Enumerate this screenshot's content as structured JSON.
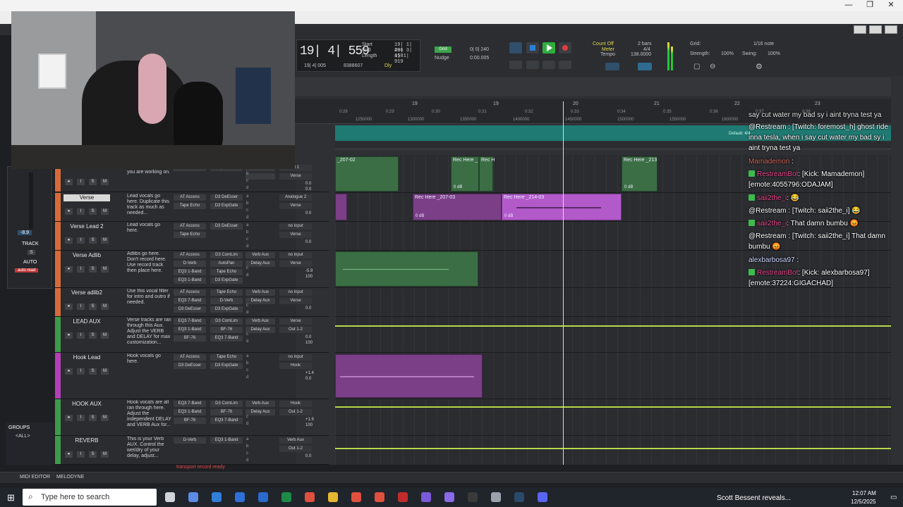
{
  "window": {
    "minimize": "—",
    "restore": "❐",
    "close": "✕"
  },
  "transport": {
    "counter": "19| 4| 559",
    "sub_counter": "19| 4| 005",
    "samples": "8388607",
    "start_label": "Start",
    "end_label": "End",
    "length_label": "Length",
    "start_val": "19| 1| 496",
    "end_val": "20| 3| 458",
    "length_val": "1| 1| 919",
    "grid_label": "Grid",
    "grid_val": "0| 0| 240",
    "nudge_label": "Nudge",
    "nudge_val": "0:00.005",
    "count_off": "Count Off",
    "bars": "2 bars",
    "meter_label": "Meter",
    "meter_val": "4/4",
    "tempo_label": "Tempo",
    "tempo_val": "138.0000",
    "grid2_label": "Grid:",
    "grid2_val": "1/16 note",
    "strength_label": "Strength:",
    "strength_val": "100%",
    "swing_label": "Swing:",
    "swing_val": "100%",
    "dly": "Dly"
  },
  "ruler": {
    "bars": [
      "19",
      "19",
      "20",
      "21",
      "22",
      "23"
    ],
    "times": [
      "0:28",
      "0:29",
      "0:30",
      "0:31",
      "0:32",
      "0:33",
      "0:34",
      "0:35",
      "0:36",
      "0:37",
      "0:38"
    ],
    "samples": [
      "1250000",
      "1300000",
      "1350000",
      "1400000",
      "1450000",
      "1500000",
      "1550000",
      "1600000"
    ],
    "default_meter": "Default: 4/4"
  },
  "tracks": [
    {
      "name": "",
      "comment": "the takes to section you are working on.",
      "inserts": [
        "",
        "Tape Echo"
      ],
      "sends": [
        "",
        "",
        "",
        ""
      ],
      "io": [
        "ut 1",
        "Verse"
      ],
      "vol": "0.0",
      "pan": "0.0"
    },
    {
      "name": "Verse",
      "comment": "Lead vocals go here. Duplicate this track as much as needed...",
      "inserts": [
        "AT Access",
        "D3 DeEsser",
        "Tape Echo",
        "D3 ExpGate"
      ],
      "io": [
        "Analogue 2",
        "Verse"
      ],
      "vol": "0.0",
      "pan": ""
    },
    {
      "name": "Verse Lead 2",
      "comment": "Lead vocals go here.",
      "inserts": [
        "AT Access",
        "D3 DeEsser",
        "Tape Echo"
      ],
      "io": [
        "no input",
        "Verse"
      ],
      "vol": "0.0",
      "pan": ""
    },
    {
      "name": "Verse Adlib",
      "comment": "Adlibs go here. Don't record here. Use record track then place here.",
      "inserts": [
        "AT Access",
        "D3 ComLim",
        "D-Verb",
        "AutoPan",
        "EQ3 1-Band",
        "Tape Echo",
        "EQ3 1-Band",
        "D3 ExpGate"
      ],
      "sends": [
        "Verb Aux",
        "Delay Aux"
      ],
      "io": [
        "no input",
        "Verse"
      ],
      "vol": "-5.9",
      "pan": "100"
    },
    {
      "name": "Verse adlib2",
      "comment": "Use this vocal filter for intro and outro if needed.",
      "inserts": [
        "AT Access",
        "Tape Echo",
        "EQ3 7-Band",
        "D-Verb",
        "D3 DeEsser",
        "D3 ExpGate"
      ],
      "sends": [
        "Verb Aux",
        "Delay Aux"
      ],
      "io": [
        "no input",
        "Verse"
      ],
      "vol": "0.0",
      "pan": ""
    },
    {
      "name": "LEAD AUX",
      "comment": "Verse tracks are ran through this Aux. Adjust the VERB and DELAY for max customization...",
      "inserts": [
        "EQ3 7-Band",
        "D3 ComLim",
        "EQ3 1-Band",
        "BF-76",
        "BF-76",
        "EQ3 7-Band"
      ],
      "sends": [
        "Verb Aux",
        "Delay Aux"
      ],
      "io": [
        "Verse",
        "Out 1-2"
      ],
      "vol": "0.0",
      "pan": "100"
    },
    {
      "name": "Hook Lead",
      "comment": "Hook vocals go here.",
      "inserts": [
        "AT Access",
        "Tape Echo",
        "D3 DeEsser",
        "D3 ExpGate"
      ],
      "io": [
        "no input",
        "Hook"
      ],
      "vol": "+1.4",
      "pan": "0.0"
    },
    {
      "name": "HOOK AUX",
      "comment": "Hook vocals are all ran through here. Adjust the independent DELAY and VERB Aux for...",
      "inserts": [
        "EQ3 7-Band",
        "D3 ComLim",
        "EQ3 1-Band",
        "BF-76",
        "BF-76",
        "EQ3 7-Band"
      ],
      "sends": [
        "Verb Aux",
        "Delay Aux"
      ],
      "io": [
        "Hook",
        "Out 1-2"
      ],
      "vol": "+1.9",
      "pan": "100"
    },
    {
      "name": "REVERB",
      "comment": "This is your Verb AUX. Control the wet/dry of your delay, adjust...",
      "inserts": [
        "D-Verb",
        "EQ3 1-Band"
      ],
      "io": [
        "Verb Aux",
        "Out 1-2"
      ],
      "vol": "0.0",
      "pan": ""
    }
  ],
  "clips": [
    {
      "name": "_207-02",
      "db": ""
    },
    {
      "name": "Rec Here _",
      "db": "0 dB"
    },
    {
      "name": "Rec H",
      "db": ""
    },
    {
      "name": "Rec Here _213",
      "db": "0 dB"
    },
    {
      "name": "Rec Here _207-03",
      "db": "0 dB"
    },
    {
      "name": "Rec Here _214-03",
      "db": "0 dB"
    }
  ],
  "mixer": {
    "track_label": "TRACK",
    "s_label": "S",
    "auto_label": "AUTO",
    "auto_mode": "auto read",
    "level": "-8.9"
  },
  "groups": {
    "title": "GROUPS",
    "all": "<ALL>"
  },
  "status": {
    "transport_ready": "transport record ready",
    "midi_editor": "MIDI EDITOR",
    "melodyne": "MELODYNE"
  },
  "chat": [
    {
      "type": "text",
      "text": "say cut water my bad sy i aint tryna test ya"
    },
    {
      "type": "restream",
      "text": "@Restream : [Twitch: foremost_h] ghost ride inna tesla, when i say cut water my bad sy i aint tryna test ya"
    },
    {
      "type": "user",
      "user": "Mamademon",
      "text": ":"
    },
    {
      "type": "bot",
      "user": "RestreamBot",
      "text": ": [Kick: Mamademon] [emote:4055796:ODAJAM]"
    },
    {
      "type": "user",
      "user": "saii2the_i",
      "text": ": 😂"
    },
    {
      "type": "restream",
      "text": "@Restream : [Twitch: saii2the_i] 😂"
    },
    {
      "type": "user",
      "user": "saii2the_i",
      "text": ": That damn bumbu 😡"
    },
    {
      "type": "restream",
      "text": "@Restream : [Twitch: saii2the_i] That damn bumbu 😡"
    },
    {
      "type": "plain",
      "user": "alexbarbosa97",
      "text": ":"
    },
    {
      "type": "bot",
      "user": "RestreamBot",
      "text": ": [Kick: alexbarbosa97] [emote:37224:GIGACHAD]"
    }
  ],
  "taskbar": {
    "search_placeholder": "Type here to search",
    "news": "Scott Bessent reveals...",
    "time": "12:07 AM",
    "date": "12/5/2025"
  },
  "colors": {
    "accent_green": "#3ea34a",
    "purple_clip": "#7b3f87",
    "aux_line": "#b9d84a",
    "tempo_lane": "#1f7a73"
  }
}
